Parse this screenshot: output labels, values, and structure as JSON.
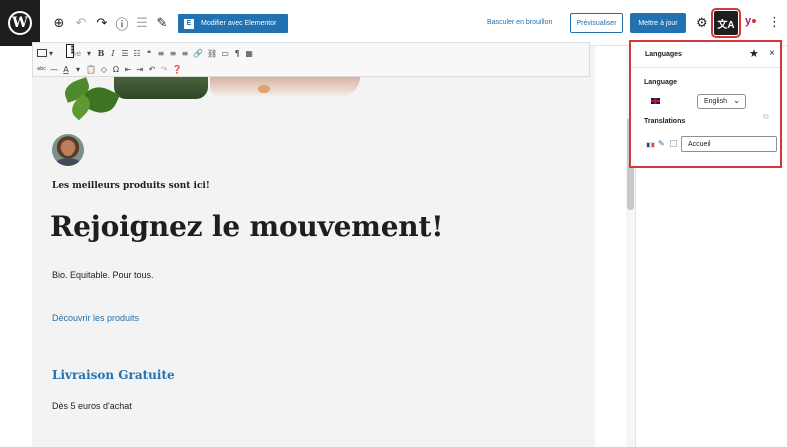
{
  "toolbar": {
    "add_icon": "⊕",
    "undo_icon": "↶",
    "redo_icon": "↷",
    "info_icon": "ⓘ",
    "list_view_icon": "☰",
    "tools_icon": "✎",
    "elementor_label": "Modifier avec Elementor",
    "elementor_badge": "E",
    "switch_draft_label": "Basculer en brouillon",
    "preview_label": "Prévisualiser",
    "update_label": "Mettre à jour",
    "settings_icon": "⚙",
    "languages_toggle_icon": "文A",
    "yoast_label": "y",
    "more_icon": "⋮",
    "accent_color": "#2271b1"
  },
  "classic_toolbar": {
    "row1": [
      "▾",
      "B",
      "I",
      "☰",
      "☷",
      "❝",
      "≡",
      "≡",
      "≡",
      "🔗",
      "⛓",
      "▭",
      "¶",
      "▦"
    ],
    "row1_paragraph_partial": "he",
    "row2": [
      "abc",
      "—",
      "A",
      "▾",
      "📋",
      "◇",
      "Ω",
      "⇤",
      "⇥",
      "↶",
      "↷",
      "❓"
    ]
  },
  "content": {
    "tagline": "Les meilleurs produits sont ici!",
    "headline": "Rejoignez le mouvement!",
    "subline": "Bio. Equitable. Pour tous.",
    "cta_link": "Découvrir les produits",
    "section_title": "Livraison Gratuite",
    "section_text": "Dès 5 euros d'achat"
  },
  "languages_panel": {
    "title": "Languages",
    "star_icon": "★",
    "close_icon": "×",
    "language_label": "Language",
    "language_value": "English",
    "chevron_icon": "⌄",
    "translations_label": "Translations",
    "translation_fr_value": "Accueil",
    "pencil_icon": "✎",
    "copy_icon": "⧉",
    "highlight_color": "#d63638"
  }
}
